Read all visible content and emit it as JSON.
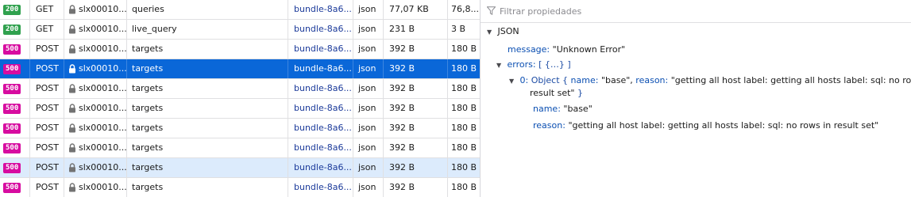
{
  "requests": [
    {
      "status": "200",
      "status_color": "#30a14e",
      "method": "GET",
      "domain": "slx00010...",
      "file": "queries",
      "initiator": "bundle-8a6...",
      "type": "json",
      "transferred": "77,07 KB",
      "size": "76,8...",
      "state": "normal"
    },
    {
      "status": "200",
      "status_color": "#30a14e",
      "method": "GET",
      "domain": "slx00010...",
      "file": "live_query",
      "initiator": "bundle-8a6...",
      "type": "json",
      "transferred": "231 B",
      "size": "3 B",
      "state": "normal"
    },
    {
      "status": "500",
      "status_color": "#d70ca0",
      "method": "POST",
      "domain": "slx00010...",
      "file": "targets",
      "initiator": "bundle-8a6...",
      "type": "json",
      "transferred": "392 B",
      "size": "180 B",
      "state": "normal"
    },
    {
      "status": "500",
      "status_color": "#d70ca0",
      "method": "POST",
      "domain": "slx00010...",
      "file": "targets",
      "initiator": "bundle-8a6...",
      "type": "json",
      "transferred": "392 B",
      "size": "180 B",
      "state": "selected"
    },
    {
      "status": "500",
      "status_color": "#d70ca0",
      "method": "POST",
      "domain": "slx00010...",
      "file": "targets",
      "initiator": "bundle-8a6...",
      "type": "json",
      "transferred": "392 B",
      "size": "180 B",
      "state": "normal"
    },
    {
      "status": "500",
      "status_color": "#d70ca0",
      "method": "POST",
      "domain": "slx00010...",
      "file": "targets",
      "initiator": "bundle-8a6...",
      "type": "json",
      "transferred": "392 B",
      "size": "180 B",
      "state": "normal"
    },
    {
      "status": "500",
      "status_color": "#d70ca0",
      "method": "POST",
      "domain": "slx00010...",
      "file": "targets",
      "initiator": "bundle-8a6...",
      "type": "json",
      "transferred": "392 B",
      "size": "180 B",
      "state": "normal"
    },
    {
      "status": "500",
      "status_color": "#d70ca0",
      "method": "POST",
      "domain": "slx00010...",
      "file": "targets",
      "initiator": "bundle-8a6...",
      "type": "json",
      "transferred": "392 B",
      "size": "180 B",
      "state": "normal"
    },
    {
      "status": "500",
      "status_color": "#d70ca0",
      "method": "POST",
      "domain": "slx00010...",
      "file": "targets",
      "initiator": "bundle-8a6...",
      "type": "json",
      "transferred": "392 B",
      "size": "180 B",
      "state": "hover"
    },
    {
      "status": "500",
      "status_color": "#d70ca0",
      "method": "POST",
      "domain": "slx00010...",
      "file": "targets",
      "initiator": "bundle-8a6...",
      "type": "json",
      "transferred": "392 B",
      "size": "180 B",
      "state": "normal"
    }
  ],
  "side_panel": {
    "filter_placeholder": "Filtrar propiedades",
    "json_header": "JSON",
    "message_key": "message:",
    "message_value": "\"Unknown Error\"",
    "errors_key": "errors:",
    "errors_preview": "[ {…} ]",
    "error0_key": "0:",
    "error0_type": "Object",
    "error0_preview_open": "{",
    "error0_name_key": "name:",
    "error0_name_value": "\"base\",",
    "error0_reason_key": "reason:",
    "error0_reason_value_line1": "\"getting all host label: getting all hosts label: sql: no rows in",
    "error0_reason_value_line2": "result set\"",
    "error0_preview_close": "}",
    "name_key": "name:",
    "name_value": "\"base\"",
    "reason_key": "reason:",
    "reason_value": "\"getting all host label: getting all hosts label: sql: no rows in result set\""
  }
}
